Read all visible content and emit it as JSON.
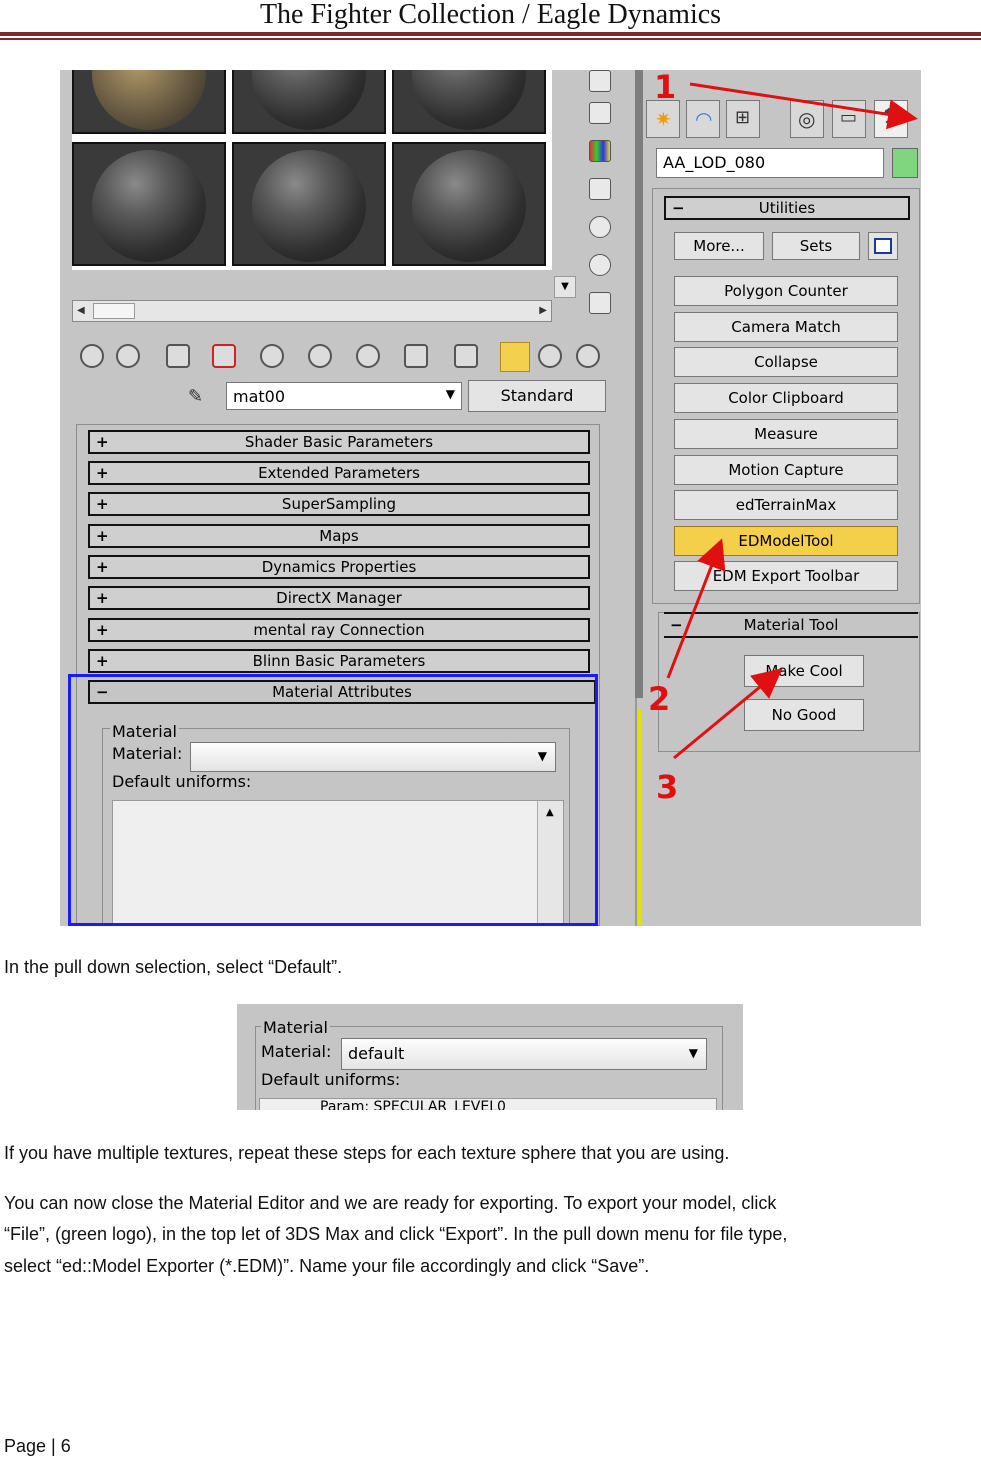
{
  "header": {
    "title": "The Fighter Collection / Eagle Dynamics"
  },
  "screenshot1": {
    "material_name": "mat00",
    "material_type_button": "Standard",
    "rollouts": [
      "Shader Basic Parameters",
      "Extended Parameters",
      "SuperSampling",
      "Maps",
      "Dynamics Properties",
      "DirectX Manager",
      "mental ray Connection",
      "Blinn Basic Parameters"
    ],
    "open_rollout": "Material Attributes",
    "material_group": {
      "title": "Material",
      "material_label": "Material:",
      "material_value": "",
      "uniforms_label": "Default uniforms:"
    },
    "object_name": "AA_LOD_080",
    "utilities": {
      "title": "Utilities",
      "more_button": "More...",
      "sets_button": "Sets",
      "items": [
        "Polygon Counter",
        "Camera Match",
        "Collapse",
        "Color Clipboard",
        "Measure",
        "Motion Capture",
        "edTerrainMax",
        "EDModelTool",
        "EDM Export Toolbar"
      ],
      "highlighted": "EDModelTool"
    },
    "material_tool": {
      "title": "Material Tool",
      "buttons": [
        "Make Cool",
        "No Good"
      ]
    },
    "annotations": [
      "1",
      "2",
      "3"
    ],
    "colors": {
      "annotation": "#e01010",
      "highlight_box": "#1a1aff",
      "selected_button": "#f3cf4a"
    }
  },
  "para1": "In the pull down selection, select “Default”.",
  "screenshot2": {
    "title": "Material",
    "material_label": "Material:",
    "material_value": "default",
    "uniforms_label": "Default uniforms:",
    "list_row": "Param: SPECULAR_LEVEL0"
  },
  "para2": "If you have multiple textures, repeat these steps for each texture sphere that you are using.",
  "para3_lines": [
    "You can now close the Material Editor and we are ready for exporting.  To export your model, click",
    "“File”, (green logo), in the top let of 3DS Max and click “Export”.  In the pull down menu for file type,",
    "select “ed::Model Exporter (*.EDM)”.  Name your file accordingly and click “Save”."
  ],
  "footer": {
    "page": "Page | 6"
  }
}
